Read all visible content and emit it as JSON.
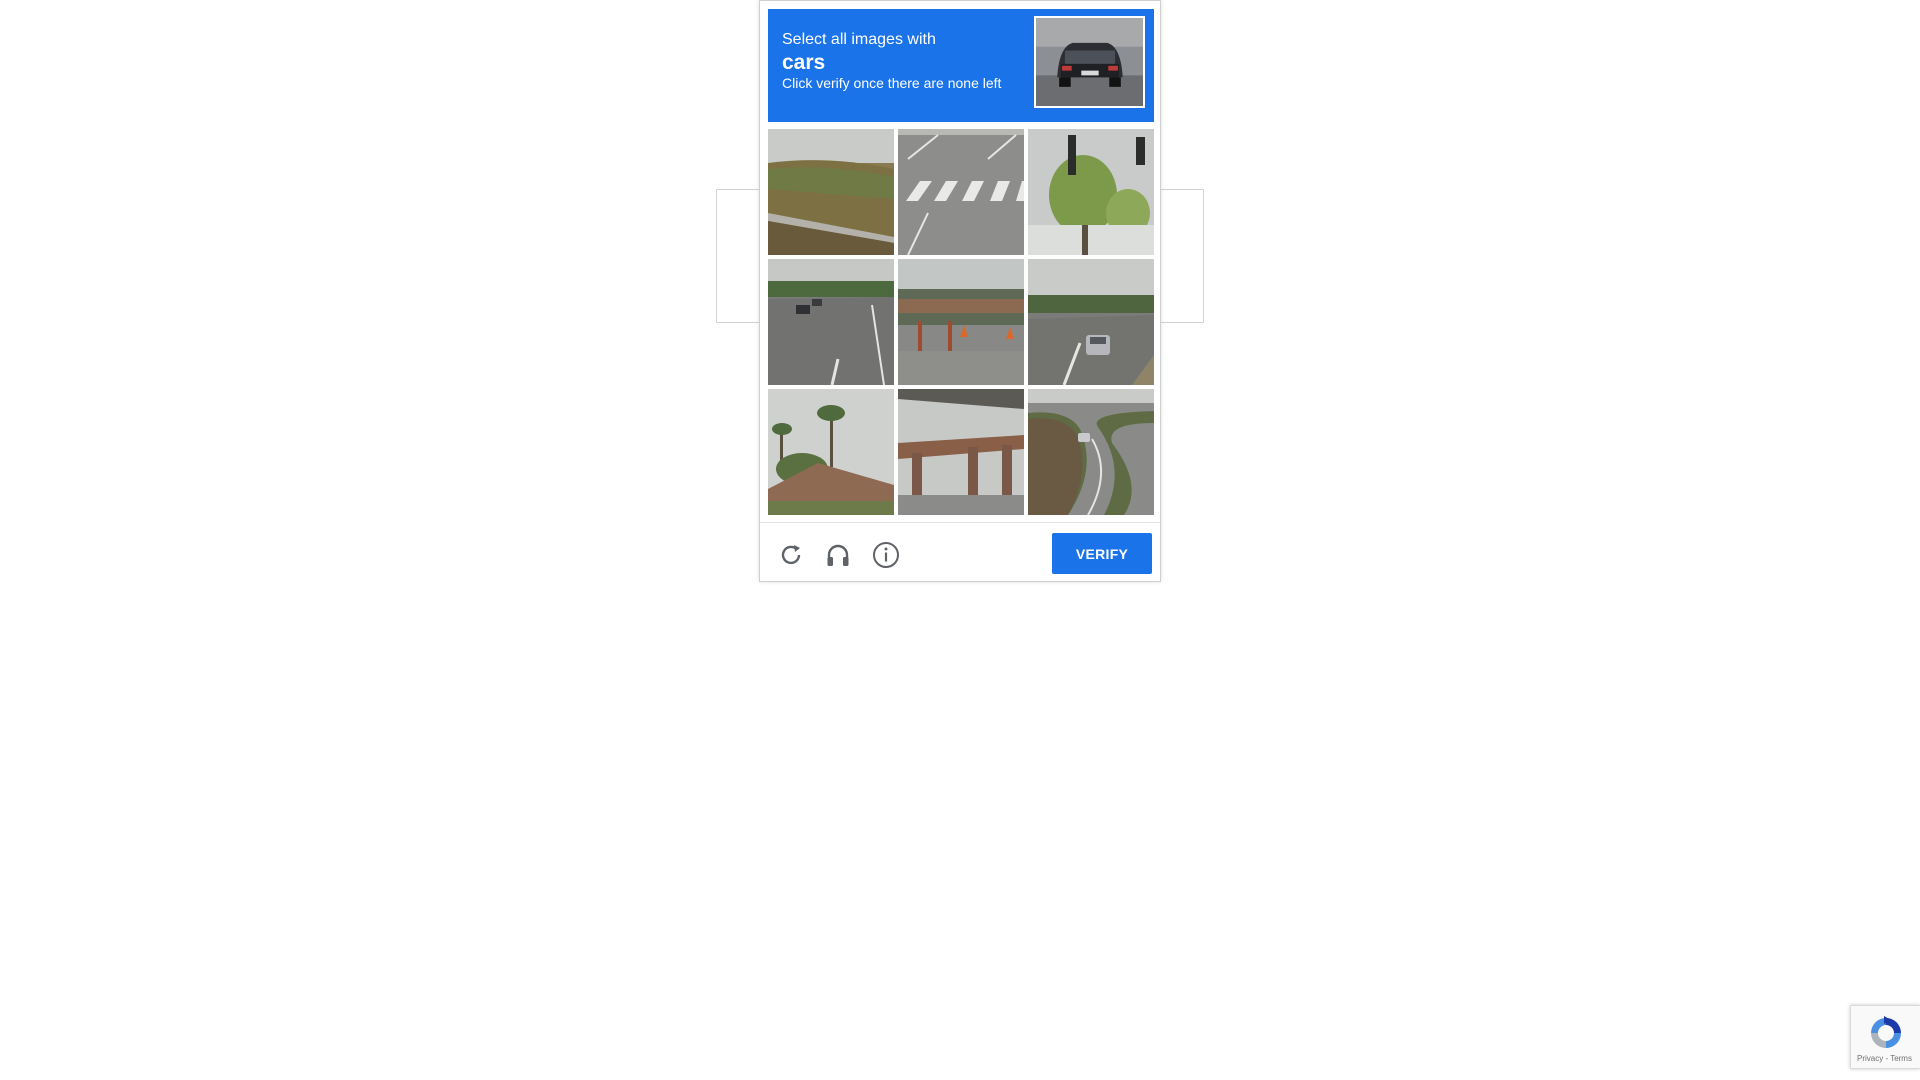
{
  "captcha": {
    "instruction_line1": "Select all images with",
    "keyword": "cars",
    "instruction_line3": "Click verify once there are none left",
    "sample_image_alt": "car from behind on road",
    "tiles": [
      {
        "alt": "grassy embankment with guardrail"
      },
      {
        "alt": "crosswalk on asphalt road"
      },
      {
        "alt": "traffic lights and tree"
      },
      {
        "alt": "highway with cars"
      },
      {
        "alt": "construction site with orange cones"
      },
      {
        "alt": "road with car"
      },
      {
        "alt": "palm trees and rooftop"
      },
      {
        "alt": "highway overpass"
      },
      {
        "alt": "winding road with car"
      }
    ],
    "reload_icon": "reload-icon",
    "audio_icon": "headphones-icon",
    "info_icon": "info-icon",
    "verify_label": "VERIFY",
    "accent_color": "#1a73e8"
  },
  "recaptcha_badge": {
    "icon": "recaptcha-logo-icon",
    "links": "Privacy - Terms"
  }
}
